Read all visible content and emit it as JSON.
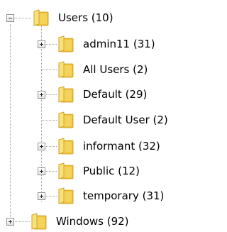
{
  "tree": {
    "root": {
      "label": "Users (10)",
      "state": "expanded"
    },
    "children": [
      {
        "label": "admin11 (31)",
        "state": "collapsed"
      },
      {
        "label": "All Users (2)",
        "state": "leaf"
      },
      {
        "label": "Default (29)",
        "state": "collapsed"
      },
      {
        "label": "Default User (2)",
        "state": "leaf"
      },
      {
        "label": "informant (32)",
        "state": "collapsed"
      },
      {
        "label": "Public (12)",
        "state": "collapsed"
      },
      {
        "label": "temporary (31)",
        "state": "collapsed"
      }
    ],
    "sibling": {
      "label": "Windows (92)",
      "state": "collapsed"
    }
  },
  "icons": {
    "folder": "folder-icon",
    "expand": "plus-icon",
    "collapse": "minus-icon"
  },
  "colors": {
    "folder_light": "#f8e27a",
    "folder_mid": "#efc23a",
    "folder_dark": "#c9981a",
    "folder_back": "#e6b030"
  }
}
